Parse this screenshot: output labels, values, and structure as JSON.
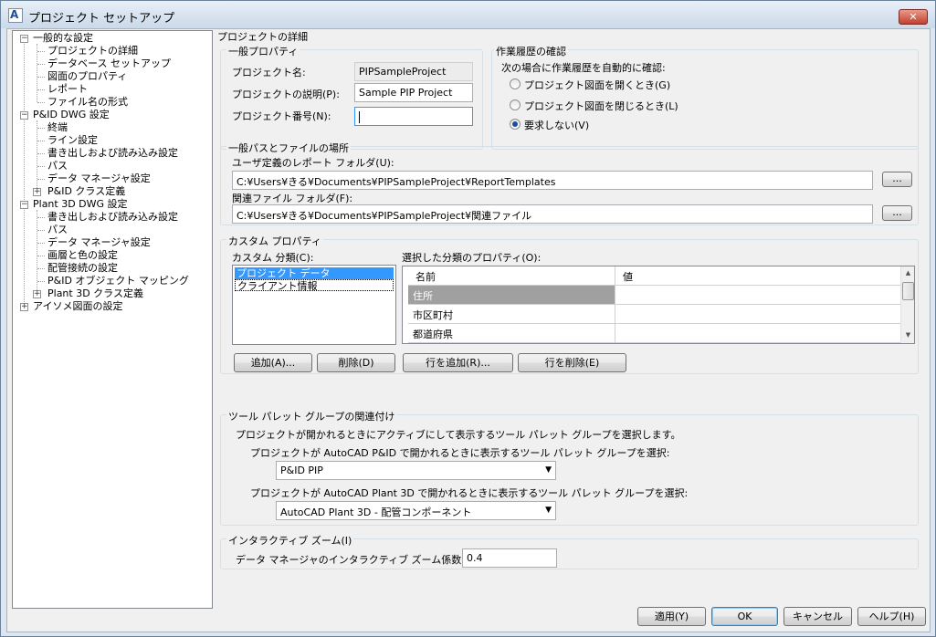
{
  "window": {
    "title": "プロジェクト セットアップ",
    "close_glyph": "✕",
    "app_icon_glyph": "A"
  },
  "tree": {
    "items": [
      {
        "label": "一般的な設定",
        "expander": "−"
      },
      {
        "label": "プロジェクトの詳細"
      },
      {
        "label": "データベース セットアップ"
      },
      {
        "label": "図面のプロパティ"
      },
      {
        "label": "レポート"
      },
      {
        "label": "ファイル名の形式"
      },
      {
        "label": "P&ID DWG 設定",
        "expander": "−"
      },
      {
        "label": "終端"
      },
      {
        "label": "ライン設定"
      },
      {
        "label": "書き出しおよび読み込み設定"
      },
      {
        "label": "パス"
      },
      {
        "label": "データ マネージャ設定"
      },
      {
        "label": "P&ID クラス定義",
        "expander": "+"
      },
      {
        "label": "Plant 3D DWG 設定",
        "expander": "−"
      },
      {
        "label": "書き出しおよび読み込み設定"
      },
      {
        "label": "パス"
      },
      {
        "label": "データ マネージャ設定"
      },
      {
        "label": "画層と色の設定"
      },
      {
        "label": "配管接続の設定"
      },
      {
        "label": "P&ID オブジェクト マッピング"
      },
      {
        "label": "Plant 3D クラス定義",
        "expander": "+"
      },
      {
        "label": "アイソメ図面の設定",
        "expander": "+"
      }
    ]
  },
  "details": {
    "heading": "プロジェクトの詳細",
    "general": {
      "title": "一般プロパティ",
      "name_label": "プロジェクト名:",
      "name_value": "PIPSampleProject",
      "desc_label": "プロジェクトの説明(P):",
      "desc_value": "Sample PIP Project",
      "number_label": "プロジェクト番号(N):",
      "number_value": ""
    },
    "history": {
      "title": "作業履歴の確認",
      "prompt": "次の場合に作業履歴を自動的に確認:",
      "options": [
        "プロジェクト図面を開くとき(G)",
        "プロジェクト図面を閉じるとき(L)",
        "要求しない(V)"
      ],
      "selected": "要求しない(V)"
    }
  },
  "paths": {
    "title": "一般パスとファイルの場所",
    "report_label": "ユーザ定義のレポート フォルダ(U):",
    "report_value": "C:¥Users¥きる¥Documents¥PIPSampleProject¥ReportTemplates",
    "related_label": "関連ファイル フォルダ(F):",
    "related_value": "C:¥Users¥きる¥Documents¥PIPSampleProject¥関連ファイル",
    "browse_label": "..."
  },
  "custom": {
    "title": "カスタム プロパティ",
    "category_label": "カスタム 分類(C):",
    "categories": [
      "プロジェクト データ",
      "クライアント情報"
    ],
    "props_label": "選択した分類のプロパティ(O):",
    "columns": [
      "名前",
      "値"
    ],
    "rows": [
      {
        "name": "住所",
        "value": ""
      },
      {
        "name": "市区町村",
        "value": ""
      },
      {
        "name": "都道府県",
        "value": ""
      }
    ],
    "buttons": {
      "add": "追加(A)...",
      "delete": "削除(D)",
      "add_row": "行を追加(R)...",
      "delete_row": "行を削除(E)"
    }
  },
  "palette": {
    "title": "ツール パレット グループの関連付け",
    "intro": "プロジェクトが開かれるときにアクティブにして表示するツール パレット グループを選択します。",
    "pid_label": "プロジェクトが AutoCAD P&ID で開かれるときに表示するツール パレット グループを選択:",
    "pid_value": "P&ID PIP",
    "plant_label": "プロジェクトが AutoCAD Plant 3D で開かれるときに表示するツール パレット グループを選択:",
    "plant_value": "AutoCAD Plant 3D - 配管コンポーネント"
  },
  "zoom": {
    "title": "インタラクティブ ズーム(I)",
    "label": "データ マネージャのインタラクティブ ズーム係数(Z):",
    "value": "0.4"
  },
  "footer": {
    "apply": "適用(Y)",
    "ok": "OK",
    "cancel": "キャンセル",
    "help": "ヘルプ(H)"
  }
}
